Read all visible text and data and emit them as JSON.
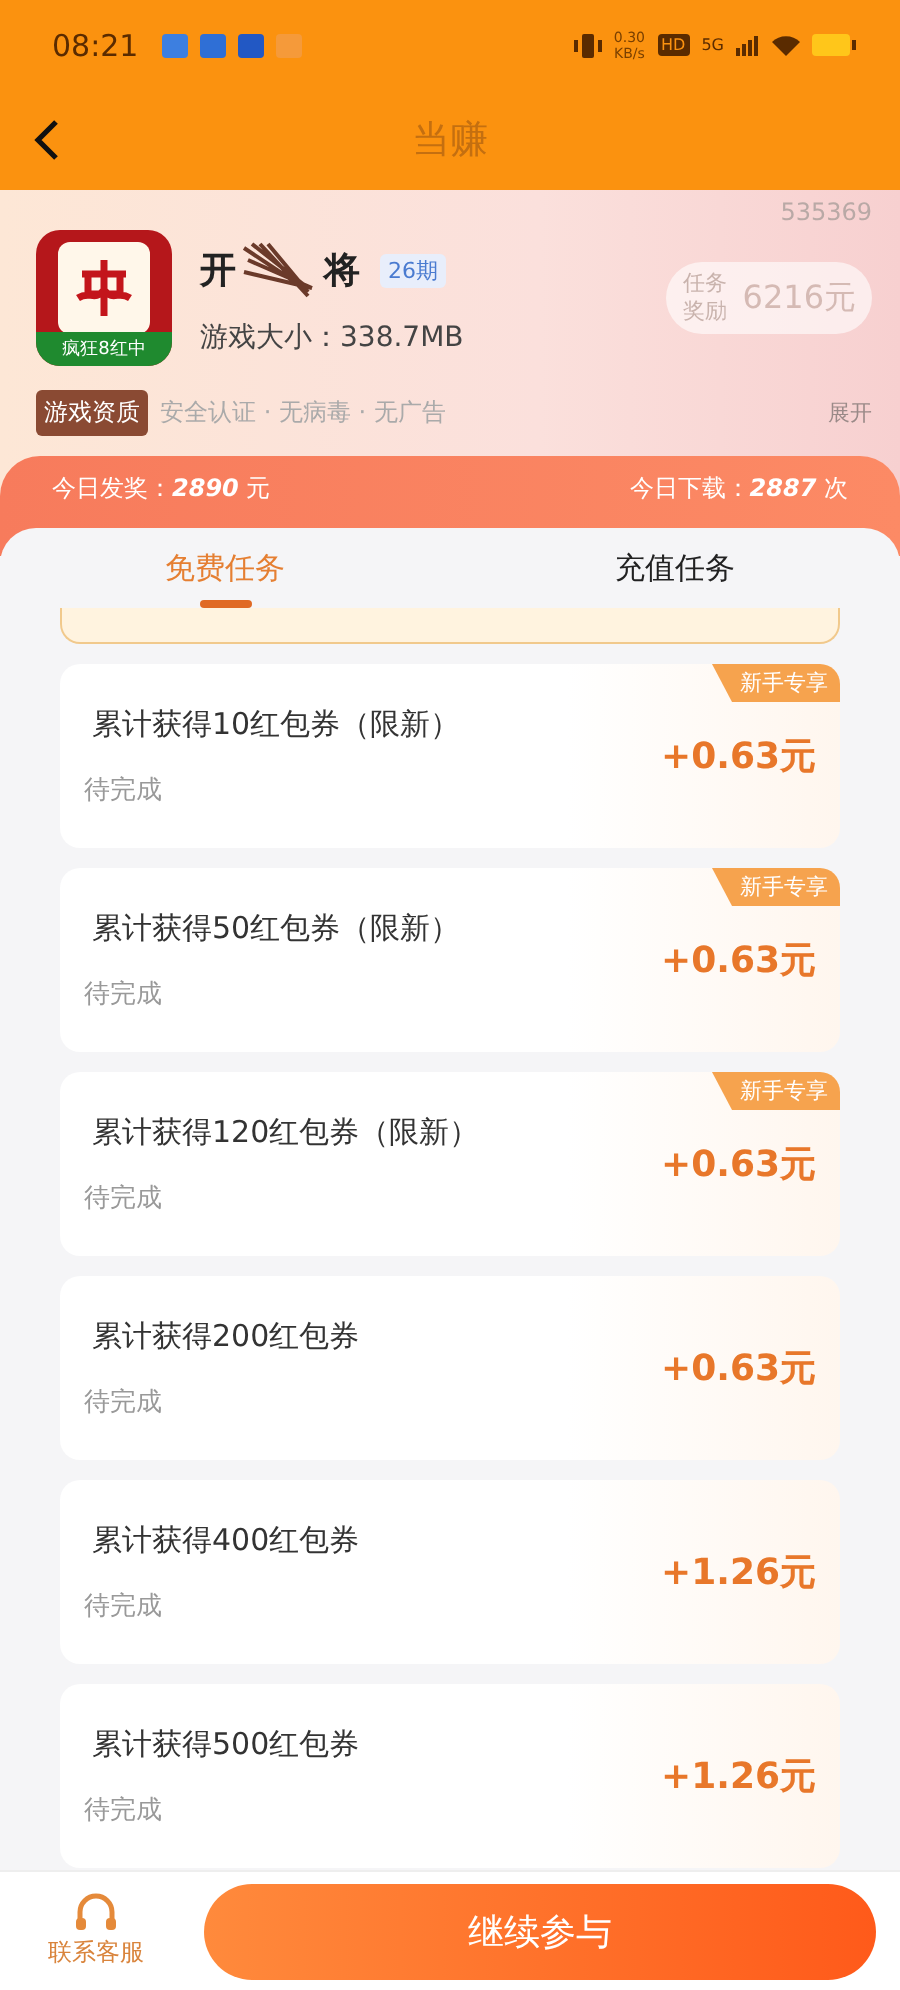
{
  "status_bar": {
    "time": "08:21",
    "speed": "0.30",
    "speed_unit": "KB/s",
    "hd": "HD",
    "network": "5G"
  },
  "nav": {
    "title": "当赚"
  },
  "game": {
    "id": "535369",
    "name_start": "开",
    "name_end": "将",
    "period": "26期",
    "icon_caption": "疯狂8红中",
    "size": "游戏大小：338.7MB",
    "reward_label": "任务奖励",
    "reward": "6216元",
    "qualification": "游戏资质",
    "features": "安全认证 · 无病毒 · 无广告",
    "expand": "展开"
  },
  "stats": [
    {
      "label": "今日发奖：",
      "value": "2890",
      "unit": "元"
    },
    {
      "label": "今日下载：",
      "value": "2887",
      "unit": "次"
    }
  ],
  "tabs": [
    {
      "label": "免费任务",
      "selected": true
    },
    {
      "label": "充值任务",
      "selected": false
    }
  ],
  "tasks": [
    {
      "title": "累计获得10红包券（限新）",
      "status": "待完成",
      "reward": "+0.63元",
      "badge": "新手专享"
    },
    {
      "title": "累计获得50红包券（限新）",
      "status": "待完成",
      "reward": "+0.63元",
      "badge": "新手专享"
    },
    {
      "title": "累计获得120红包券（限新）",
      "status": "待完成",
      "reward": "+0.63元",
      "badge": "新手专享"
    },
    {
      "title": "累计获得200红包券",
      "status": "待完成",
      "reward": "+0.63元"
    },
    {
      "title": "累计获得400红包券",
      "status": "待完成",
      "reward": "+1.26元"
    },
    {
      "title": "累计获得500红包券",
      "status": "待完成",
      "reward": "+1.26元"
    }
  ],
  "bottom": {
    "support": "联系客服",
    "action": "继续参与"
  }
}
